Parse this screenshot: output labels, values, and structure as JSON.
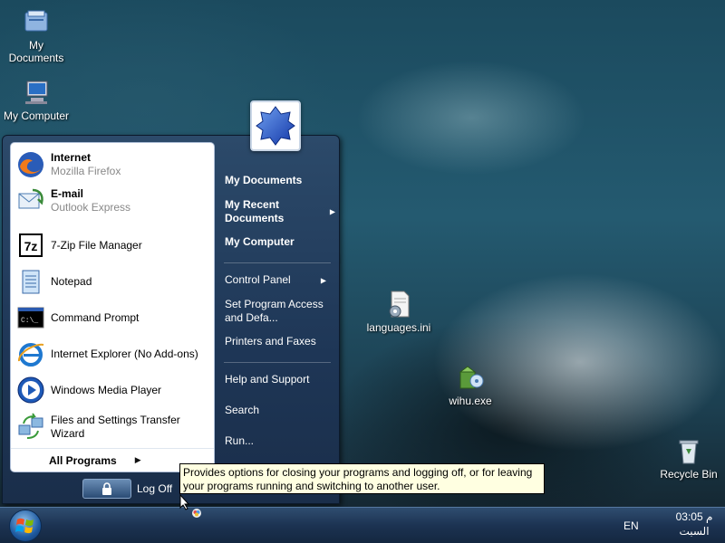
{
  "desktop": {
    "icons": [
      {
        "label": "My\nDocuments"
      },
      {
        "label": "My Computer"
      },
      {
        "label": "languages.ini"
      },
      {
        "label": "wihu.exe"
      },
      {
        "label": "Recycle Bin"
      }
    ],
    "partial_label": "ni"
  },
  "start_menu": {
    "pinned": [
      {
        "title": "Internet",
        "subtitle": "Mozilla Firefox",
        "icon": "firefox-icon"
      },
      {
        "title": "E-mail",
        "subtitle": "Outlook Express",
        "icon": "outlook-express-icon"
      }
    ],
    "recent": [
      {
        "label": "7-Zip File Manager",
        "icon": "7zip-icon"
      },
      {
        "label": "Notepad",
        "icon": "notepad-icon"
      },
      {
        "label": "Command Prompt",
        "icon": "command-prompt-icon"
      },
      {
        "label": "Internet Explorer (No Add-ons)",
        "icon": "internet-explorer-icon"
      },
      {
        "label": "Windows Media Player",
        "icon": "media-player-icon"
      },
      {
        "label": "Files and Settings Transfer Wizard",
        "icon": "transfer-wizard-icon"
      }
    ],
    "all_programs": "All Programs",
    "right": {
      "my_documents": "My Documents",
      "my_recent_documents": "My Recent Documents",
      "my_computer": "My Computer",
      "control_panel": "Control Panel",
      "set_program_access": "Set Program Access and Defa...",
      "printers_faxes": "Printers and Faxes",
      "help_support": "Help and Support",
      "search": "Search",
      "run": "Run..."
    },
    "log_off": "Log Off"
  },
  "tooltip": "Provides options for closing your programs and logging off, or for leaving your programs running and switching to another user.",
  "taskbar": {
    "language": "EN",
    "clock_time": "03:05 م",
    "clock_day": "السبت"
  },
  "colors": {
    "menu_bg": "#1e3656",
    "taskbar_bg": "#1c3352",
    "tooltip_bg": "#ffffe1"
  }
}
